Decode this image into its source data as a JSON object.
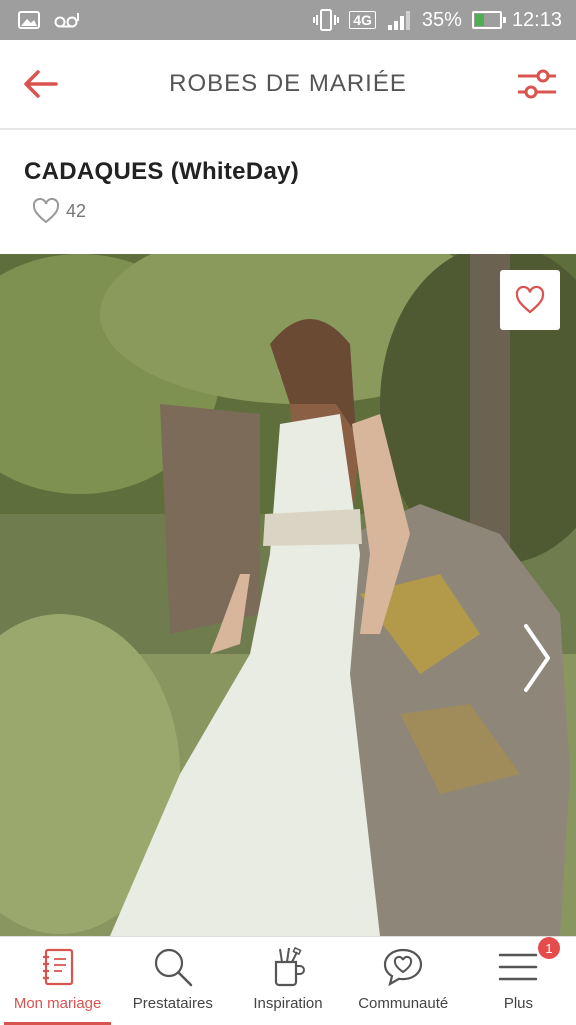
{
  "status_bar": {
    "network": "4G",
    "battery": "35%",
    "battery_level": 0.35,
    "time": "12:13"
  },
  "app_bar": {
    "title": "ROBES DE MARIÉE",
    "back_icon": "arrow-left-icon",
    "filter_icon": "sliders-icon"
  },
  "dress": {
    "name": "CADAQUES (WhiteDay)",
    "likes": "42"
  },
  "colors": {
    "accent": "#d9534f",
    "status_bar": "#9e9e9e"
  },
  "tabs": [
    {
      "label": "Mon mariage",
      "icon": "notebook-icon",
      "active": true
    },
    {
      "label": "Prestataires",
      "icon": "search-icon",
      "active": false
    },
    {
      "label": "Inspiration",
      "icon": "mug-icon",
      "active": false
    },
    {
      "label": "Communauté",
      "icon": "chat-heart-icon",
      "active": false
    },
    {
      "label": "Plus",
      "icon": "menu-icon",
      "active": false,
      "badge": "1"
    }
  ]
}
